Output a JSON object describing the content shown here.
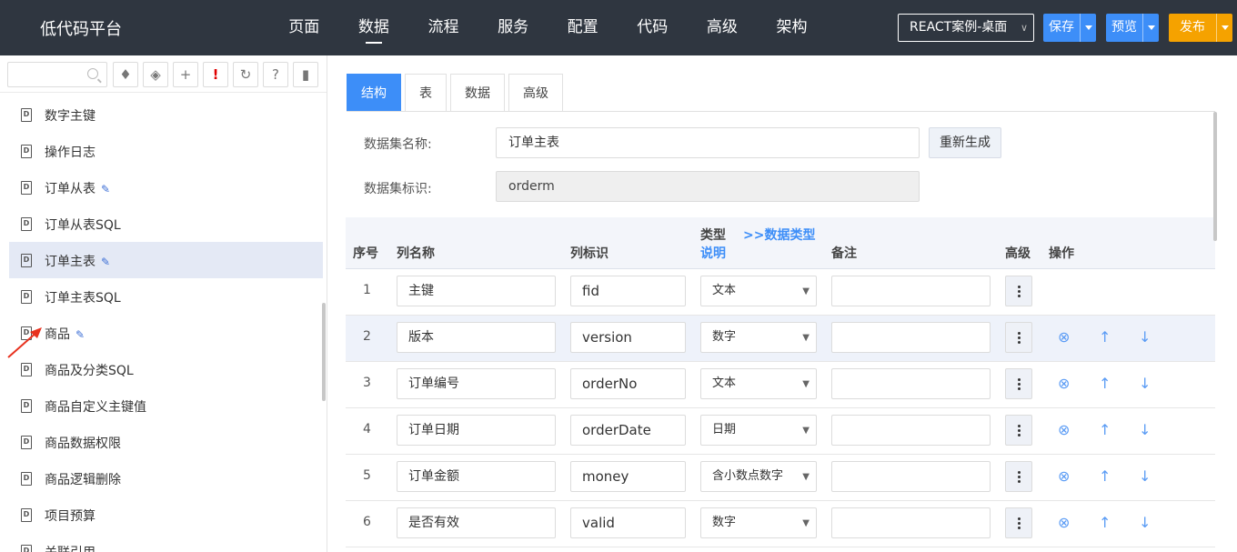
{
  "app": {
    "title": "低代码平台"
  },
  "nav": {
    "items": [
      "页面",
      "数据",
      "流程",
      "服务",
      "配置",
      "代码",
      "高级",
      "架构"
    ],
    "active": "数据"
  },
  "header": {
    "env_select": "REACT案例-桌面",
    "save": "保存",
    "preview": "预览",
    "publish": "发布"
  },
  "sidebar": {
    "search_placeholder": "",
    "toolbar": [
      "tree-icon",
      "tag-icon",
      "plus-icon",
      "exclamation-icon",
      "refresh-icon",
      "help-icon",
      "window-icon"
    ],
    "items": [
      {
        "label": "数字主键",
        "edit": false
      },
      {
        "label": "操作日志",
        "edit": false
      },
      {
        "label": "订单从表",
        "edit": true
      },
      {
        "label": "订单从表SQL",
        "edit": false
      },
      {
        "label": "订单主表",
        "edit": true,
        "selected": true
      },
      {
        "label": "订单主表SQL",
        "edit": false
      },
      {
        "label": "商品",
        "edit": true
      },
      {
        "label": "商品及分类SQL",
        "edit": false
      },
      {
        "label": "商品自定义主键值",
        "edit": false
      },
      {
        "label": "商品数据权限",
        "edit": false
      },
      {
        "label": "商品逻辑删除",
        "edit": false
      },
      {
        "label": "项目预算",
        "edit": false
      },
      {
        "label": "关联引用",
        "edit": false
      }
    ]
  },
  "tabs": [
    "结构",
    "表",
    "数据",
    "高级"
  ],
  "active_tab": "结构",
  "form": {
    "name_label": "数据集名称:",
    "name_value": "订单主表",
    "regen_button": "重新生成",
    "id_label": "数据集标识:",
    "id_value": "orderm"
  },
  "grid": {
    "headers": {
      "no": "序号",
      "col_name": "列名称",
      "col_id": "列标识",
      "type_top": "类型",
      "type_bottom": "说明",
      "type_link": ">>数据类型",
      "note": "备注",
      "advanced": "高级",
      "ops": "操作"
    },
    "rows": [
      {
        "no": "1",
        "name": "主键",
        "id": "fid",
        "type": "文本",
        "note": "",
        "ops": false
      },
      {
        "no": "2",
        "name": "版本",
        "id": "version",
        "type": "数字",
        "note": "",
        "ops": true,
        "highlight": true
      },
      {
        "no": "3",
        "name": "订单编号",
        "id": "orderNo",
        "type": "文本",
        "note": "",
        "ops": true
      },
      {
        "no": "4",
        "name": "订单日期",
        "id": "orderDate",
        "type": "日期",
        "note": "",
        "ops": true
      },
      {
        "no": "5",
        "name": "订单金额",
        "id": "money",
        "type": "含小数点数字",
        "note": "",
        "ops": true
      },
      {
        "no": "6",
        "name": "是否有效",
        "id": "valid",
        "type": "数字",
        "note": "",
        "ops": true
      }
    ]
  },
  "colors": {
    "topbar": "#2f3640",
    "primary": "#3d8ef8",
    "publish": "#f5a200",
    "selected": "#e4e9f5"
  }
}
